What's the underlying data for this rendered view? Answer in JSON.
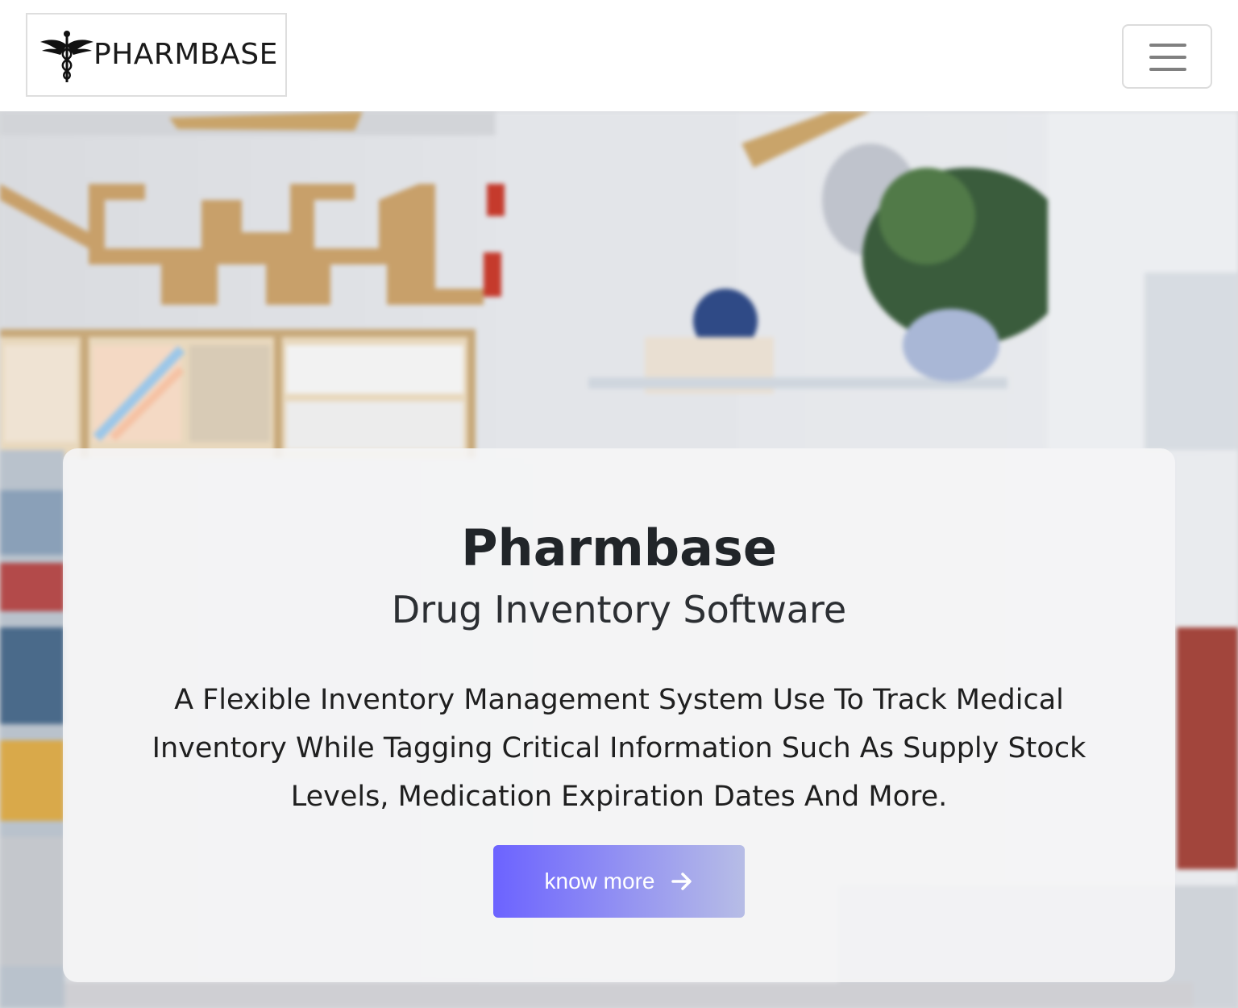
{
  "navbar": {
    "brand_text": "PHARMBASE",
    "logo_icon": "caduceus-icon",
    "menu_icon": "hamburger-menu-icon"
  },
  "hero": {
    "title": "Pharmbase",
    "subtitle": "Drug Inventory Software",
    "description": "A Flexible Inventory Management System Use To Track Medical Inventory While Tagging Critical Information Such As Supply Stock Levels, Medication Expiration Dates And More.",
    "button_label": "know more",
    "button_icon": "arrow-right-icon",
    "background": "blurred pharmacy store photo"
  },
  "colors": {
    "accent_start": "#6c63ff",
    "accent_end": "#b7bde6",
    "text": "#212529"
  }
}
